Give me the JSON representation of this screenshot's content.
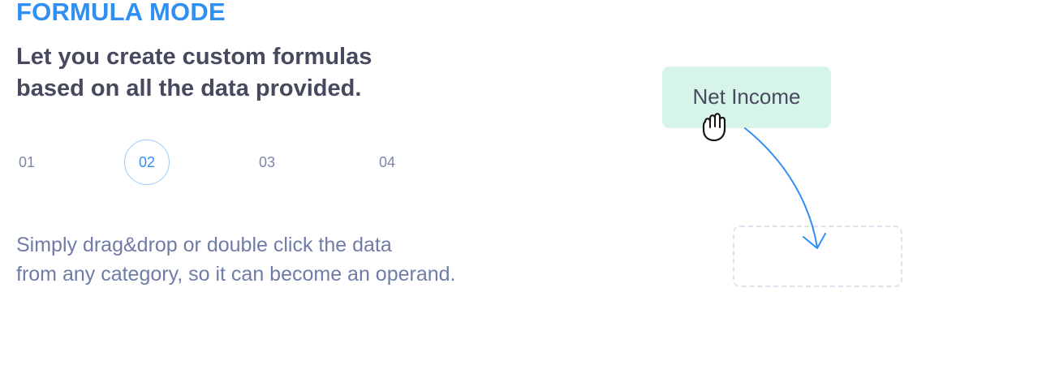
{
  "section": {
    "eyebrow": "FORMULA MODE",
    "headline_lines": [
      "Let you create custom formulas",
      "based on all the data provided."
    ]
  },
  "steps": {
    "items": [
      "01",
      "02",
      "03",
      "04"
    ],
    "active": "02"
  },
  "description_lines": [
    "Simply drag&drop or double click the data",
    "from any category, so it can become an operand."
  ],
  "demo": {
    "chip_label": "Net Income",
    "accent_color": "#2f8ff3",
    "chip_color": "#d6f4e7",
    "cursor_icon": "grab-hand-icon",
    "arrow_icon": "curved-arrow-icon"
  }
}
